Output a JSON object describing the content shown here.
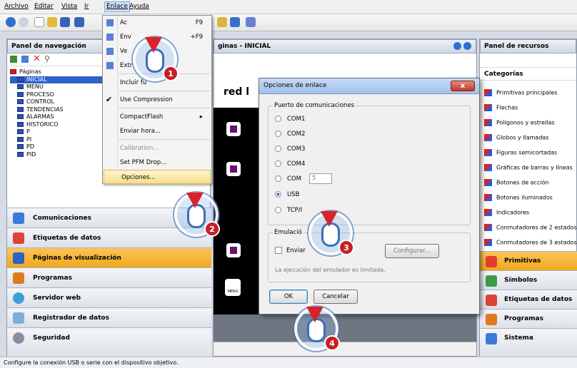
{
  "menubar": {
    "items": [
      "Archivo",
      "Editar",
      "Vista",
      "Ir",
      "Enlace",
      "Ayuda"
    ]
  },
  "nav": {
    "title": "Panel de navegación",
    "root": "Páginas",
    "pages": [
      "INICIAL",
      "MENU",
      "PROCESO",
      "CONTROL",
      "TENDENCIAS",
      "ALARMAS",
      "HISTORICO",
      "P",
      "PI",
      "PD",
      "PID"
    ],
    "categories": [
      "Comunicaciones",
      "Etiquetas de datos",
      "Páginas de visualización",
      "Programas",
      "Servidor web",
      "Registrador de datos",
      "Seguridad"
    ]
  },
  "center": {
    "title": "ginas - INICIAL",
    "logo_text": "red l",
    "menu_label": "MENU"
  },
  "resources": {
    "title": "Panel de recursos",
    "categories_title": "Categorías",
    "items": [
      "Primitivas principales",
      "Flechas",
      "Polígonos y estrellas",
      "Globos y llamadas",
      "Figuras semicortadas",
      "Gráficas de barras y líneas",
      "Botones de acción",
      "Botones iluminados",
      "Indicadores",
      "Conmutadores de 2 estados",
      "Conmutadores de 3 estados"
    ],
    "buttons": [
      "Primitivas",
      "Símbolos",
      "Etiquetas de datos",
      "Programas",
      "Sistema"
    ]
  },
  "menu": {
    "items": [
      {
        "label": "Ac",
        "shortcut": "F9"
      },
      {
        "label": "Env",
        "shortcut": "+F9"
      },
      {
        "label": "Ve",
        "shortcut": ""
      },
      {
        "label": "Extr",
        "shortcut": ""
      },
      {
        "label": "Incluir fu",
        "shortcut": ""
      },
      {
        "label": "Use Compression",
        "shortcut": ""
      },
      {
        "label": "CompactFlash",
        "shortcut": "▸"
      },
      {
        "label": "Enviar hora...",
        "shortcut": ""
      },
      {
        "label": "Calibration...",
        "shortcut": ""
      },
      {
        "label": "Set PFM Drop...",
        "shortcut": ""
      },
      {
        "label": "Opciones...",
        "shortcut": ""
      }
    ]
  },
  "dialog": {
    "title": "Opciones de enlace",
    "close": "x",
    "group_ports": "Puerto de comunicaciones",
    "ports": [
      "COM1",
      "COM2",
      "COM3",
      "COM4",
      "COM",
      "USB",
      "TCP/I"
    ],
    "com_value": "5",
    "group_emul": "Emulació",
    "emul_check": "Enviar",
    "configure": "Configurar...",
    "note": "La ejecución del emulador es limitada.",
    "ok": "OK",
    "cancel": "Cancelar"
  },
  "status": "Configure la conexión USB o serie con el dispositivo objetivo.",
  "steps": [
    "1",
    "2",
    "3",
    "4"
  ]
}
